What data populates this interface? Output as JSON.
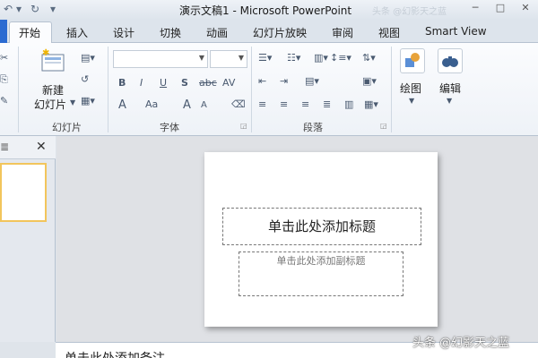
{
  "titlebar": {
    "title": "演示文稿1  -  Microsoft PowerPoint"
  },
  "tabs": [
    "开始",
    "插入",
    "设计",
    "切换",
    "动画",
    "幻灯片放映",
    "审阅",
    "视图",
    "Smart View"
  ],
  "ribbon": {
    "slides_group": {
      "new_slide_line1": "新建",
      "new_slide_line2": "幻灯片",
      "label": "幻灯片"
    },
    "font_group": {
      "label": "字体",
      "bold": "B",
      "italic": "I",
      "underline": "U",
      "shadow": "S",
      "strike": "abc",
      "spacing": "AV",
      "font_color": "A",
      "change_case": "Aa",
      "grow": "A",
      "shrink": "A"
    },
    "paragraph_group": {
      "label": "段落"
    },
    "drawing": {
      "label": "绘图"
    },
    "editing": {
      "label": "编辑"
    }
  },
  "slide": {
    "title_placeholder": "单击此处添加标题",
    "subtitle_placeholder": "单击此处添加副标题"
  },
  "notes": {
    "placeholder": "单击此处添加备注"
  },
  "watermark": "头条 @幻影天之蓝",
  "icons": {
    "undo": "↶",
    "redo": "↻",
    "qat_menu": "▾",
    "close": "✕",
    "minimize": "─",
    "maximize": "□",
    "pane_close": "✕",
    "pane_list": "≣"
  },
  "colors": {
    "accent": "#2b6bd1",
    "thumb_border": "#f2c55c",
    "ribbon_bg": "#fbfcfe"
  }
}
